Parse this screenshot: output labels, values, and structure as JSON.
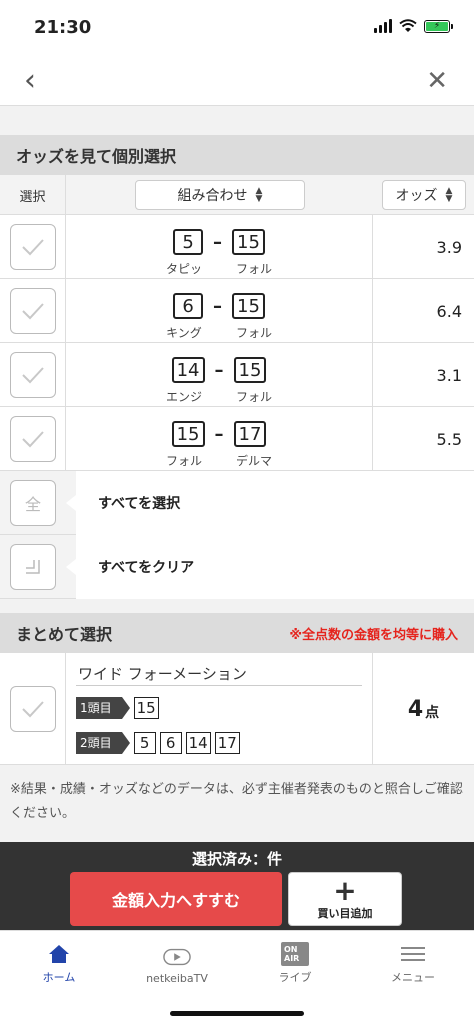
{
  "status": {
    "time": "21:30"
  },
  "individual": {
    "title": "オッズを見て個別選択",
    "col_select": "選択",
    "col_combo": "組み合わせ",
    "col_odds": "オッズ",
    "rows": [
      {
        "num1": "5",
        "num2": "15",
        "name1": "タピッ",
        "name2": "フォル",
        "odds": "3.9"
      },
      {
        "num1": "6",
        "num2": "15",
        "name1": "キング",
        "name2": "フォル",
        "odds": "6.4"
      },
      {
        "num1": "14",
        "num2": "15",
        "name1": "エンジ",
        "name2": "フォル",
        "odds": "3.1"
      },
      {
        "num1": "15",
        "num2": "17",
        "name1": "フォル",
        "name2": "デルマ",
        "odds": "5.5"
      }
    ],
    "select_all_icon": "全",
    "select_all": "すべてを選択",
    "clear_all": "すべてをクリア"
  },
  "bulk": {
    "title": "まとめて選択",
    "note": "※全点数の金額を均等に購入",
    "type": "ワイド フォーメーション",
    "head1_label": "1頭目",
    "head1": [
      "15"
    ],
    "head2_label": "2頭目",
    "head2": [
      "5",
      "6",
      "14",
      "17"
    ],
    "points": "4",
    "points_unit": "点"
  },
  "disclaimer": "※結果・成績・オッズなどのデータは、必ず主催者発表のものと照合しご確認ください。",
  "bottom": {
    "selected": "選択済み：件",
    "amount_button": "金額入力へすすむ",
    "add_button": "買い目追加"
  },
  "tabs": {
    "home": "ホーム",
    "tv": "netkeibaTV",
    "live": "ライブ",
    "live_badge": "ON AIR",
    "menu": "メニュー"
  }
}
